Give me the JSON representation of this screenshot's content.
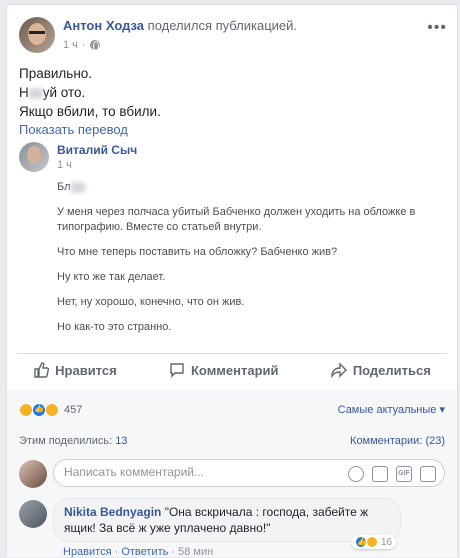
{
  "post": {
    "author": "Антон Ходза",
    "action": "поделился публикацией.",
    "time": "1 ч",
    "lines": [
      "Правильно.",
      "Н",
      "уй ото.",
      "Якщо вбили, то вбили."
    ],
    "translate": "Показать перевод"
  },
  "shared": {
    "author": "Виталий Сыч",
    "time": "1 ч",
    "greeting": "Бл",
    "paragraphs": [
      "У меня через полчаса убитый Бабченко должен уходить на обложке в типографию. Вместе со статьей внутри.",
      "Что мне теперь поставить на обложку? Бабченко жив?",
      "Ну кто же так делает.",
      "Нет, ну хорошо, конечно, что он жив.",
      "Но как-то это странно."
    ]
  },
  "actions": {
    "like": "Нравится",
    "comment": "Комментарий",
    "share": "Поделиться"
  },
  "reactions": {
    "count": "457",
    "icons": [
      "haha",
      "like",
      "wow"
    ]
  },
  "sort": {
    "label": "Самые актуальные ▾"
  },
  "stats": {
    "shared_label": "Этим поделились:",
    "shared_count": "13",
    "comments_label": "Комментарии:",
    "comments_count": "(23)"
  },
  "composer": {
    "placeholder": "Написать комментарий..."
  },
  "comment": {
    "author": "Nikita Bednyagin",
    "text": "\"Она вскричала : господа, забейте ж ящик! За всё ж уже уплачено давно!\"",
    "reactions_count": "16",
    "like": "Нравится",
    "reply": "Ответить",
    "time": "58 мин"
  }
}
